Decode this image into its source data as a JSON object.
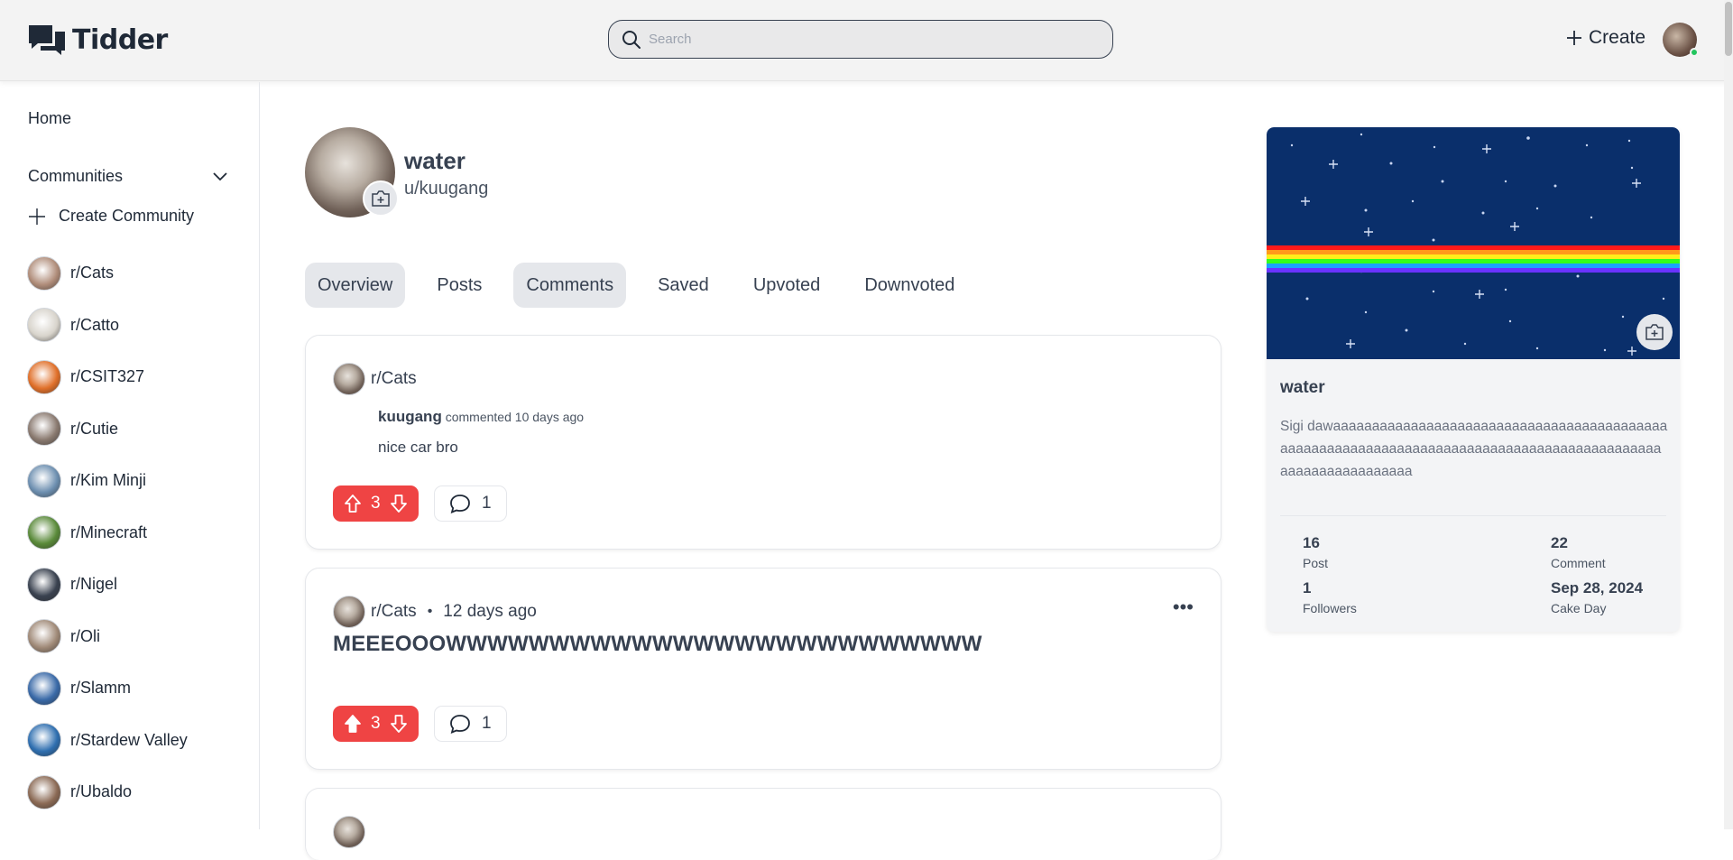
{
  "app": {
    "name": "Tidder",
    "search_placeholder": "Search",
    "create_label": "Create"
  },
  "sidebar": {
    "home": "Home",
    "communities": "Communities",
    "create_community": "Create Community",
    "items": [
      {
        "label": "r/Cats",
        "color": "#b08d7a"
      },
      {
        "label": "r/Catto",
        "color": "#d8d4cc"
      },
      {
        "label": "r/CSIT327",
        "color": "#e0702a"
      },
      {
        "label": "r/Cutie",
        "color": "#8a7a70"
      },
      {
        "label": "r/Kim Minji",
        "color": "#6d8fb0"
      },
      {
        "label": "r/Minecraft",
        "color": "#5a8a3a"
      },
      {
        "label": "r/Nigel",
        "color": "#3a4250"
      },
      {
        "label": "r/Oli",
        "color": "#a08a78"
      },
      {
        "label": "r/Slamm",
        "color": "#3a6aa8"
      },
      {
        "label": "r/Stardew Valley",
        "color": "#2f6fb0"
      },
      {
        "label": "r/Ubaldo",
        "color": "#8b6a55"
      }
    ]
  },
  "profile": {
    "name": "water",
    "handle": "u/kuugang"
  },
  "tabs": [
    {
      "label": "Overview",
      "active": true
    },
    {
      "label": "Posts",
      "active": false
    },
    {
      "label": "Comments",
      "active": true
    },
    {
      "label": "Saved",
      "active": false
    },
    {
      "label": "Upvoted",
      "active": false
    },
    {
      "label": "Downvoted",
      "active": false
    }
  ],
  "feed": {
    "comment_card": {
      "community": "r/Cats",
      "author": "kuugang",
      "action": "commented",
      "time": "10 days ago",
      "body": "nice car bro",
      "votes": "3",
      "comments": "1"
    },
    "post_card": {
      "community": "r/Cats",
      "separator": "•",
      "time": "12 days ago",
      "title": "MEEEOOOWWWWWWWWWWWWWWWWWWWWWWWWWW",
      "votes": "3",
      "comments": "1"
    }
  },
  "panel": {
    "name": "water",
    "desc": "Sigi dawaaaaaaaaaaaaaaaaaaaaaaaaaaaaaaaaaaaaaaaaaaaaaaaaaaaaaaaaaaaaaaaaaaaaaaaaaaaaaaaaaaaaaaaaaaaaaaaaaaaaaaaaaaaaa",
    "stats": {
      "posts_value": "16",
      "posts_label": "Post",
      "comments_value": "22",
      "comments_label": "Comment",
      "followers_value": "1",
      "followers_label": "Followers",
      "cakeday_value": "Sep 28, 2024",
      "cakeday_label": "Cake Day"
    }
  },
  "colors": {
    "accent_red": "#ef4444",
    "online": "#22c55e",
    "banner": "#0a2f6b"
  }
}
